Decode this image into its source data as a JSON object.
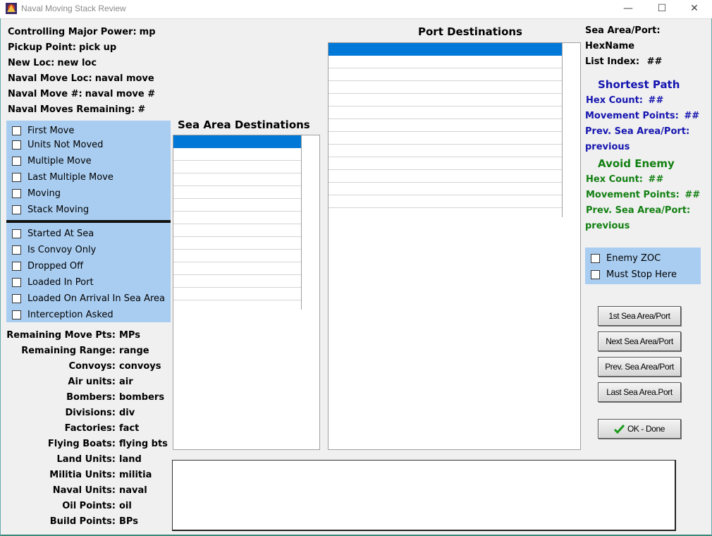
{
  "window": {
    "title": "Naval Moving Stack Review",
    "minimize": "—",
    "maximize": "☐",
    "close": "✕"
  },
  "info": [
    {
      "label": "Controlling Major Power:",
      "value": "mp"
    },
    {
      "label": "Pickup Point:",
      "value": "pick up"
    },
    {
      "label": "New Loc:",
      "value": "new loc"
    },
    {
      "label": "Naval Move Loc:",
      "value": "naval move"
    },
    {
      "label": "Naval Move #:",
      "value": "naval move #"
    },
    {
      "label": "Naval Moves Remaining:",
      "value": "#"
    }
  ],
  "status_checks_1": [
    "First Move",
    "Units Not Moved",
    "Multiple Move",
    "Last Multiple Move",
    "Moving",
    "Stack Moving"
  ],
  "status_checks_2": [
    "Started At Sea",
    "Is Convoy Only",
    "Dropped Off",
    "Loaded In Port",
    "Loaded On Arrival In Sea Area",
    "Interception Asked"
  ],
  "stats": [
    {
      "label": "Remaining Move Pts:",
      "value": "MPs"
    },
    {
      "label": "Remaining Range:",
      "value": "range"
    },
    {
      "label": "Convoys:",
      "value": "convoys"
    },
    {
      "label": "Air units:",
      "value": "air"
    },
    {
      "label": "Bombers:",
      "value": "bombers"
    },
    {
      "label": "Divisions:",
      "value": "div"
    },
    {
      "label": "Factories:",
      "value": "fact"
    },
    {
      "label": "Flying Boats:",
      "value": "flying bts"
    },
    {
      "label": "Land Units:",
      "value": "land"
    },
    {
      "label": "Militia Units:",
      "value": "militia"
    },
    {
      "label": "Naval Units:",
      "value": "naval"
    },
    {
      "label": "Oil Points:",
      "value": "oil"
    },
    {
      "label": "Build Points:",
      "value": "BPs"
    }
  ],
  "sea_area": {
    "heading": "Sea Area Destinations"
  },
  "port": {
    "heading": "Port Destinations"
  },
  "right": {
    "sea_area_port": "Sea Area/Port:",
    "hexname": "HexName",
    "list_index_label": "List Index:",
    "list_index_value": "##",
    "shortest_path": {
      "heading": "Shortest Path",
      "hex_count_label": "Hex Count:",
      "hex_count_value": "##",
      "mp_label": "Movement Points:",
      "mp_value": "##",
      "prev_label": "Prev. Sea Area/Port:",
      "prev_value": "previous"
    },
    "avoid_enemy": {
      "heading": "Avoid Enemy",
      "hex_count_label": "Hex Count:",
      "hex_count_value": "##",
      "mp_label": "Movement Points:",
      "mp_value": "##",
      "prev_label": "Prev. Sea Area/Port:",
      "prev_value": "previous"
    },
    "enemy_zoc": "Enemy ZOC",
    "must_stop": "Must Stop Here"
  },
  "buttons": {
    "first": "1st Sea Area/Port",
    "next": "Next Sea Area/Port",
    "prev": "Prev. Sea Area/Port",
    "last": "Last Sea Area.Port",
    "ok": "OK - Done"
  },
  "colors": {
    "blue_panel": "#a9cdf1",
    "selection": "#0078d7",
    "blue_text": "#1515b0",
    "green_text": "#128012"
  }
}
